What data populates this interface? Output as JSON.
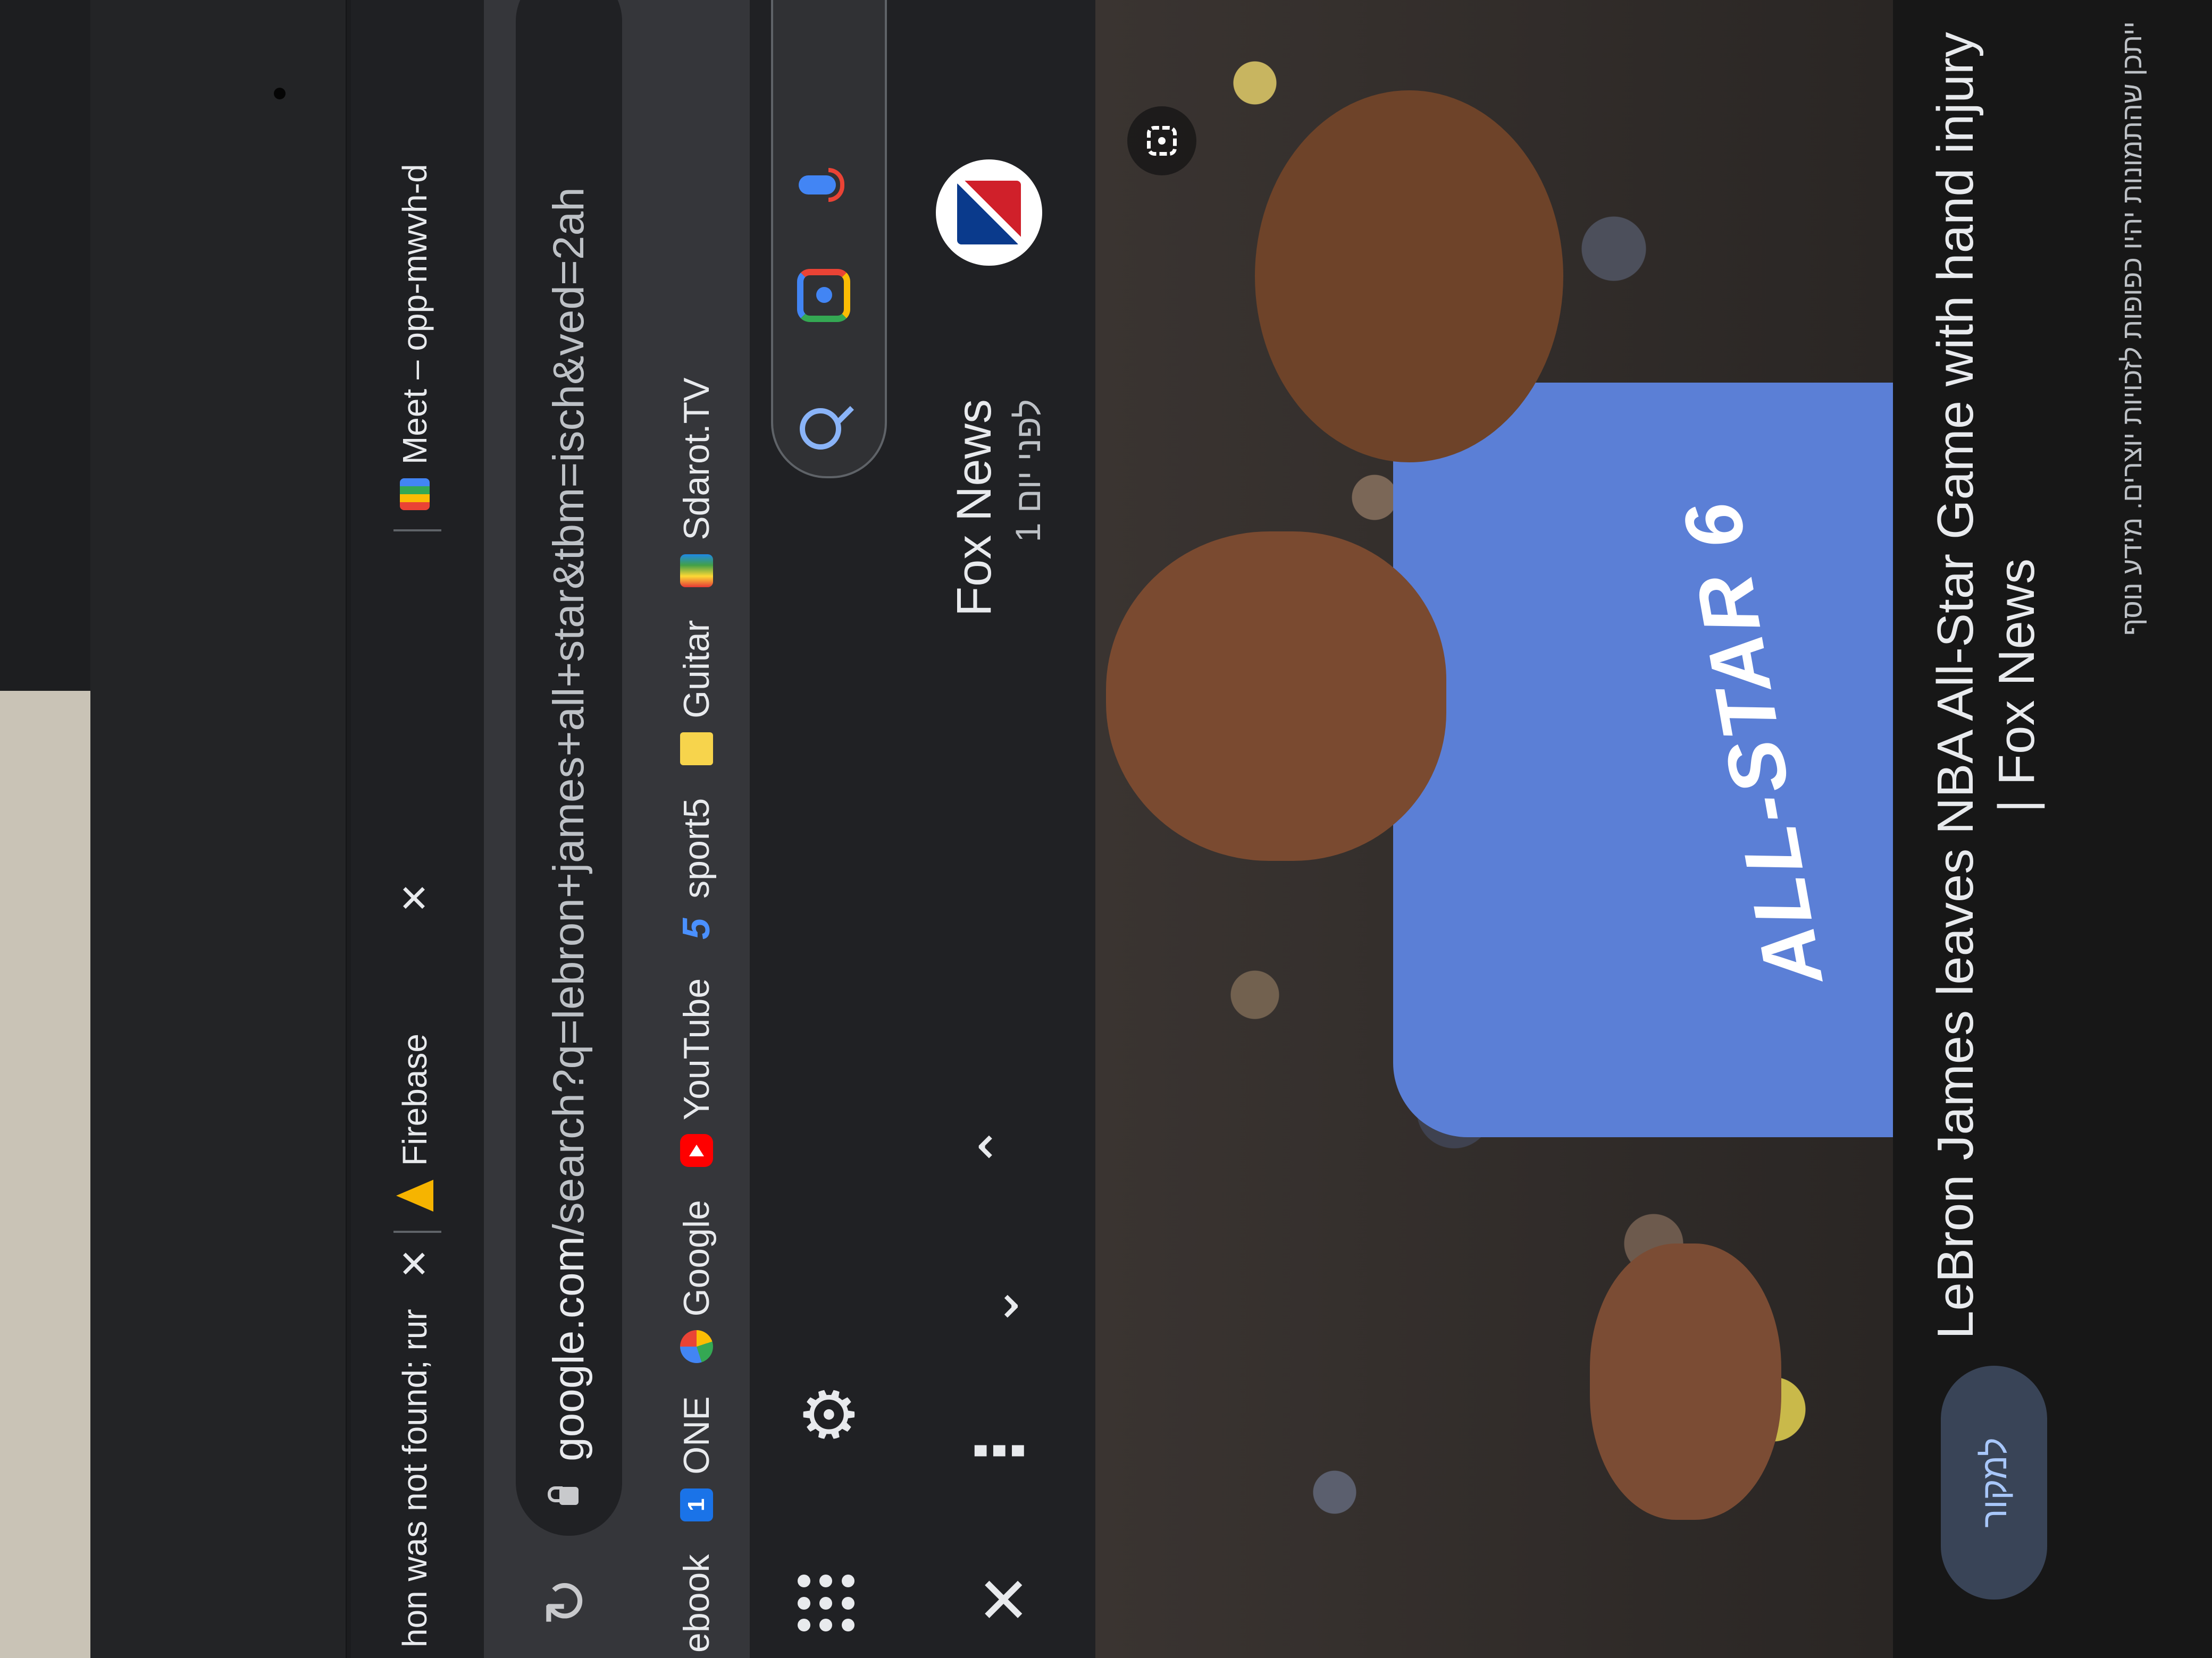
{
  "tabs": [
    {
      "title": "hon was not found; rur"
    },
    {
      "title": "Firebase"
    },
    {
      "title": "Meet – opp-mwvh-d"
    }
  ],
  "address_bar": {
    "host": "google.com",
    "path": "/search?q=lebron+james+all+star&tbm=isch&ved=2ah"
  },
  "bookmarks": [
    {
      "label": "ebook",
      "icon": "facebook-icon"
    },
    {
      "label": "ONE",
      "icon": "one-icon"
    },
    {
      "label": "Google",
      "icon": "google-icon"
    },
    {
      "label": "YouTube",
      "icon": "youtube-icon"
    },
    {
      "label": "sport5",
      "icon": "sport5-icon"
    },
    {
      "label": "Guitar",
      "icon": "folder-icon"
    },
    {
      "label": "Sdarot.TV",
      "icon": "sdarot-icon"
    }
  ],
  "preview": {
    "source_name": "Fox News",
    "source_time": "לפני יום 1",
    "title": "LeBron James leaves NBA All-Star Game with hand injury | Fox News",
    "note": "ייתכן שהתמונות יהיו כפופות לזכויות יוצרים. מידע נוסף",
    "visit_label": "למקור",
    "jersey_text": "ALL-STAR 6"
  },
  "colors": {
    "page_bg": "#202124",
    "toolbar_bg": "#35363a",
    "accent_blue": "#8ab4f8",
    "visit_button_bg": "#394457"
  }
}
